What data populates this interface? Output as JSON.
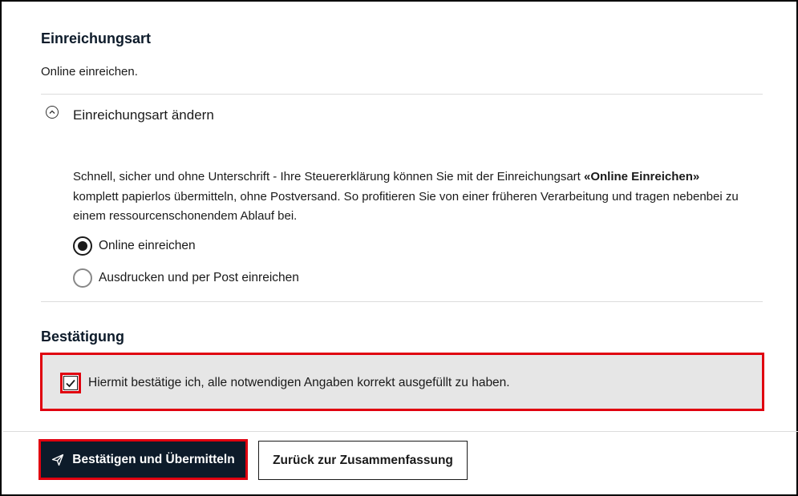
{
  "submission": {
    "title": "Einreichungsart",
    "current_value": "Online einreichen.",
    "accordion_label": "Einreichungsart ändern",
    "accordion_icon": "chevron-up-circle-icon",
    "description_part1": "Schnell, sicher und ohne Unterschrift - Ihre Steuererklärung können Sie mit der Einreichungsart ",
    "description_bold": "«Online Einreichen»",
    "description_part2": " komplett papierlos übermitteln, ohne Postversand. So profitieren Sie von einer früheren Verarbeitung und tragen nebenbei zu einem ressourcenschonendem Ablauf bei.",
    "options": [
      {
        "label": "Online einreichen",
        "selected": true
      },
      {
        "label": "Ausdrucken und per Post einreichen",
        "selected": false
      }
    ]
  },
  "confirmation": {
    "title": "Bestätigung",
    "checkbox_label": "Hiermit bestätige ich, alle notwendigen Angaben korrekt ausgefüllt zu haben.",
    "checked": true
  },
  "actions": {
    "primary_label": "Bestätigen und Übermitteln",
    "primary_icon": "send-icon",
    "secondary_label": "Zurück zur Zusammenfassung"
  },
  "colors": {
    "highlight": "#e0000f",
    "primary_button": "#0d1b2a",
    "confirm_background": "#e6e6e6"
  }
}
